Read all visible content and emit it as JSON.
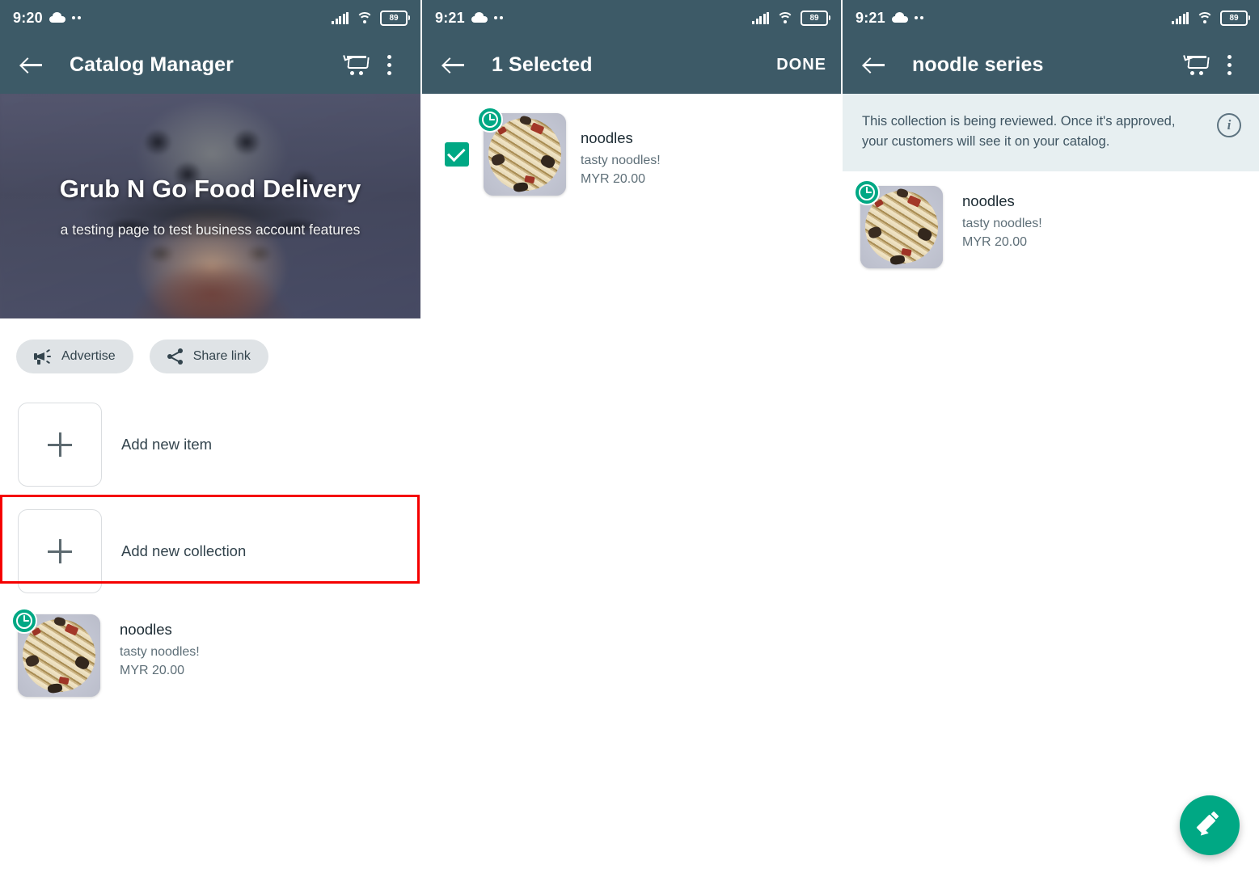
{
  "panels": [
    {
      "status": {
        "time": "9:20",
        "battery": "89",
        "cloud_icon": "cloud-icon",
        "dots_icon": "more-dots-icon",
        "signal_icon": "signal-bars-icon",
        "wifi_icon": "wifi-icon"
      },
      "appbar": {
        "title": "Catalog Manager",
        "back_icon": "back-arrow-icon",
        "cart_icon": "shopping-cart-icon",
        "menu_icon": "overflow-menu-icon"
      },
      "hero": {
        "title": "Grub N Go Food Delivery",
        "subtitle": "a testing page to test business account features"
      },
      "pills": [
        {
          "label": "Advertise",
          "icon": "megaphone-icon"
        },
        {
          "label": "Share link",
          "icon": "share-icon"
        }
      ],
      "add_item": {
        "label": "Add new item",
        "icon": "plus-icon"
      },
      "add_collection": {
        "label": "Add new collection",
        "icon": "plus-icon",
        "highlighted": true,
        "highlight_color": "#f50000"
      },
      "product": {
        "name": "noodles",
        "description": "tasty noodles!",
        "price": "MYR 20.00",
        "badge": "pending-clock-icon"
      }
    },
    {
      "status": {
        "time": "9:21",
        "battery": "89"
      },
      "appbar": {
        "title": "1 Selected",
        "back_icon": "back-arrow-icon",
        "done_label": "DONE"
      },
      "product": {
        "name": "noodles",
        "description": "tasty noodles!",
        "price": "MYR 20.00",
        "badge": "pending-clock-icon",
        "checked": true
      }
    },
    {
      "status": {
        "time": "9:21",
        "battery": "89"
      },
      "appbar": {
        "title": "noodle series",
        "back_icon": "back-arrow-icon",
        "cart_icon": "shopping-cart-icon",
        "menu_icon": "overflow-menu-icon"
      },
      "info_banner": {
        "text": "This collection is being reviewed. Once it's approved, your customers will see it on your catalog.",
        "icon": "info-icon"
      },
      "product": {
        "name": "noodles",
        "description": "tasty noodles!",
        "price": "MYR 20.00",
        "badge": "pending-clock-icon"
      },
      "fab": {
        "icon": "edit-pencil-icon"
      }
    }
  ],
  "colors": {
    "appbar": "#3d5a67",
    "accent_green": "#00a884",
    "info_banner_bg": "#e7eff1",
    "pill_bg": "#dfe3e6",
    "highlight_red": "#f50000"
  }
}
